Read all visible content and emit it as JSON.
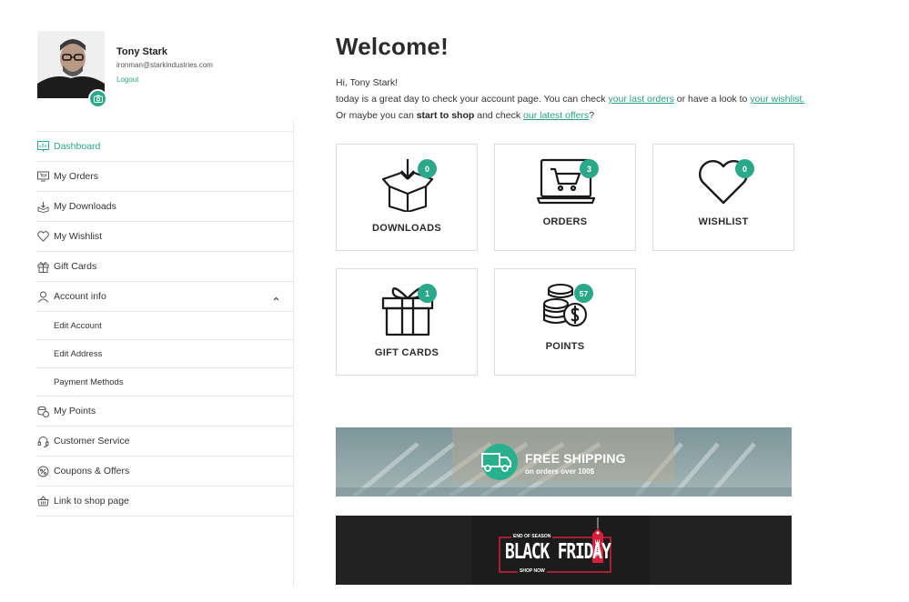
{
  "profile": {
    "name": "Tony Stark",
    "email": "ironman@starkindustries.com",
    "logout": "Logout"
  },
  "menu": {
    "dashboard": "Dashboard",
    "orders": "My Orders",
    "downloads": "My Downloads",
    "wishlist": "My Wishlist",
    "gift_cards": "Gift Cards",
    "account_info": "Account info",
    "edit_account": "Edit Account",
    "edit_address": "Edit Address",
    "payment_methods": "Payment Methods",
    "points": "My Points",
    "customer_service": "Customer Service",
    "coupons": "Coupons & Offers",
    "shop_link": "Link to shop page"
  },
  "main": {
    "title": "Welcome!",
    "greeting": "Hi, Tony Stark!",
    "line2_a": "today is a great day to check your account page. You can check ",
    "line2_link1": "your last orders",
    "line2_b": " or have a look to ",
    "line2_link2": "your wishlist.",
    "line3_a": "Or maybe you can ",
    "line3_bold": "start to shop",
    "line3_b": " and check ",
    "line3_link": "our latest offers",
    "line3_c": "?"
  },
  "cards": {
    "downloads": {
      "label": "DOWNLOADS",
      "count": "0"
    },
    "orders": {
      "label": "ORDERS",
      "count": "3"
    },
    "wishlist": {
      "label": "WISHLIST",
      "count": "0"
    },
    "gift_cards": {
      "label": "GIFT CARDS",
      "count": "1"
    },
    "points": {
      "label": "POINTS",
      "count": "57"
    }
  },
  "banners": {
    "shipping_title": "FREE SHIPPING",
    "shipping_sub": "on orders over 100$",
    "bf_top": "END OF SEASON",
    "bf_main": "BLACK FRIDAY",
    "bf_bottom": "SHOP NOW",
    "bf_tag": "SALE"
  },
  "colors": {
    "accent": "#2aa889",
    "text": "#333333"
  }
}
